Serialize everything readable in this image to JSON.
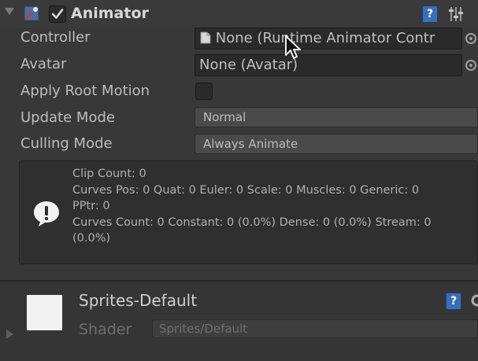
{
  "component": {
    "title": "Animator",
    "enabled": true
  },
  "fields": {
    "controller": {
      "label": "Controller",
      "value": "None (Runtime Animator Contr"
    },
    "avatar": {
      "label": "Avatar",
      "value": "None (Avatar)"
    },
    "apply_root_motion": {
      "label": "Apply Root Motion",
      "checked": false
    },
    "update_mode": {
      "label": "Update Mode",
      "value": "Normal"
    },
    "culling_mode": {
      "label": "Culling Mode",
      "value": "Always Animate"
    }
  },
  "info": {
    "line1": "Clip Count: 0",
    "line2": "Curves Pos: 0 Quat: 0 Euler: 0 Scale: 0 Muscles: 0 Generic: 0",
    "line3": "PPtr: 0",
    "line4": "Curves Count: 0 Constant: 0 (0.0%) Dense: 0 (0.0%) Stream: 0",
    "line5": "(0.0%)"
  },
  "material": {
    "name": "Sprites-Default",
    "shader_label": "Shader",
    "shader_value": "Sprites/Default"
  },
  "help_glyph": "?",
  "colors": {
    "panel_bg": "#383838",
    "help_blue": "#3a6fb6",
    "text": "#c6c6c6",
    "swatch": "#f2f2f2"
  }
}
